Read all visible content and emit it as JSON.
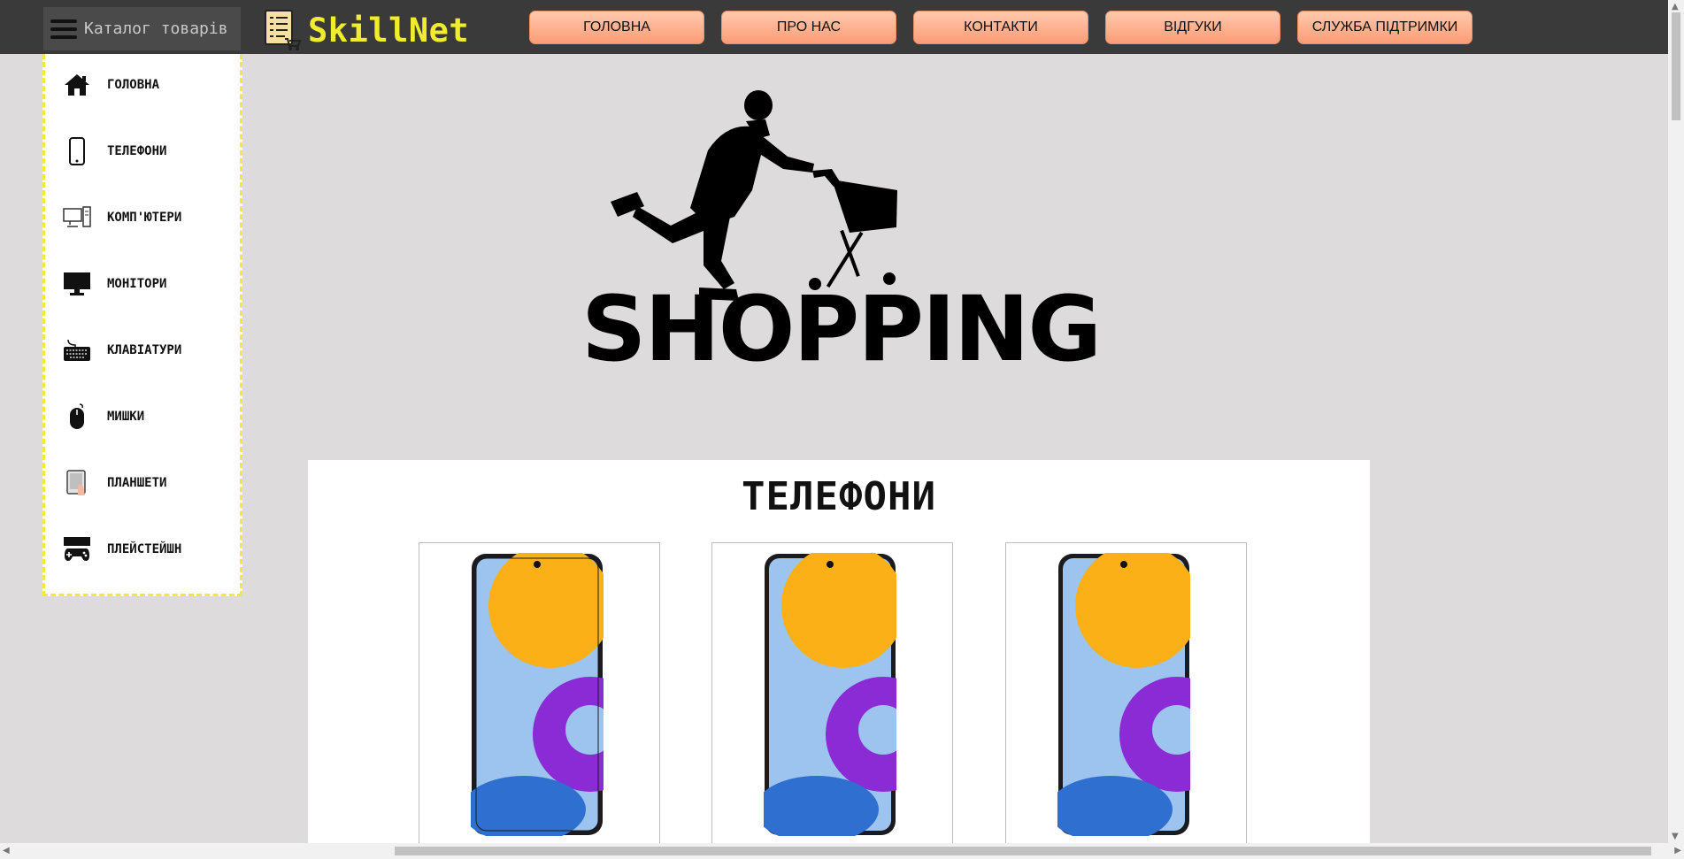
{
  "header": {
    "catalog_label": "Каталог товарів",
    "logo_text": "SkillNet",
    "nav": [
      "ГОЛОВНА",
      "ПРО НАС",
      "КОНТАКТИ",
      "ВІДГУКИ",
      "СЛУЖБА ПІДТРИМКИ"
    ]
  },
  "sidebar": {
    "items": [
      {
        "label": "ГОЛОВНА",
        "icon": "home-icon"
      },
      {
        "label": "ТЕЛЕФОНИ",
        "icon": "phone-icon"
      },
      {
        "label": "КОМП'ЮТЕРИ",
        "icon": "computer-icon"
      },
      {
        "label": "МОНІТОРИ",
        "icon": "monitor-icon"
      },
      {
        "label": "КЛАВІАТУРИ",
        "icon": "keyboard-icon"
      },
      {
        "label": "МИШКИ",
        "icon": "mouse-icon"
      },
      {
        "label": "ПЛАНШЕТИ",
        "icon": "tablet-icon"
      },
      {
        "label": "ПЛЕЙСТЕЙШН",
        "icon": "gamepad-icon"
      }
    ]
  },
  "hero": {
    "text": "SHOPPING"
  },
  "section": {
    "title": "ТЕЛЕФОНИ",
    "cards": 3
  },
  "colors": {
    "topbar": "#3a3a3a",
    "logo": "#f1ec2c",
    "nav_button": "#fdb28f",
    "sidebar_border": "#f2ea3a",
    "page_bg": "#dddbdc"
  }
}
